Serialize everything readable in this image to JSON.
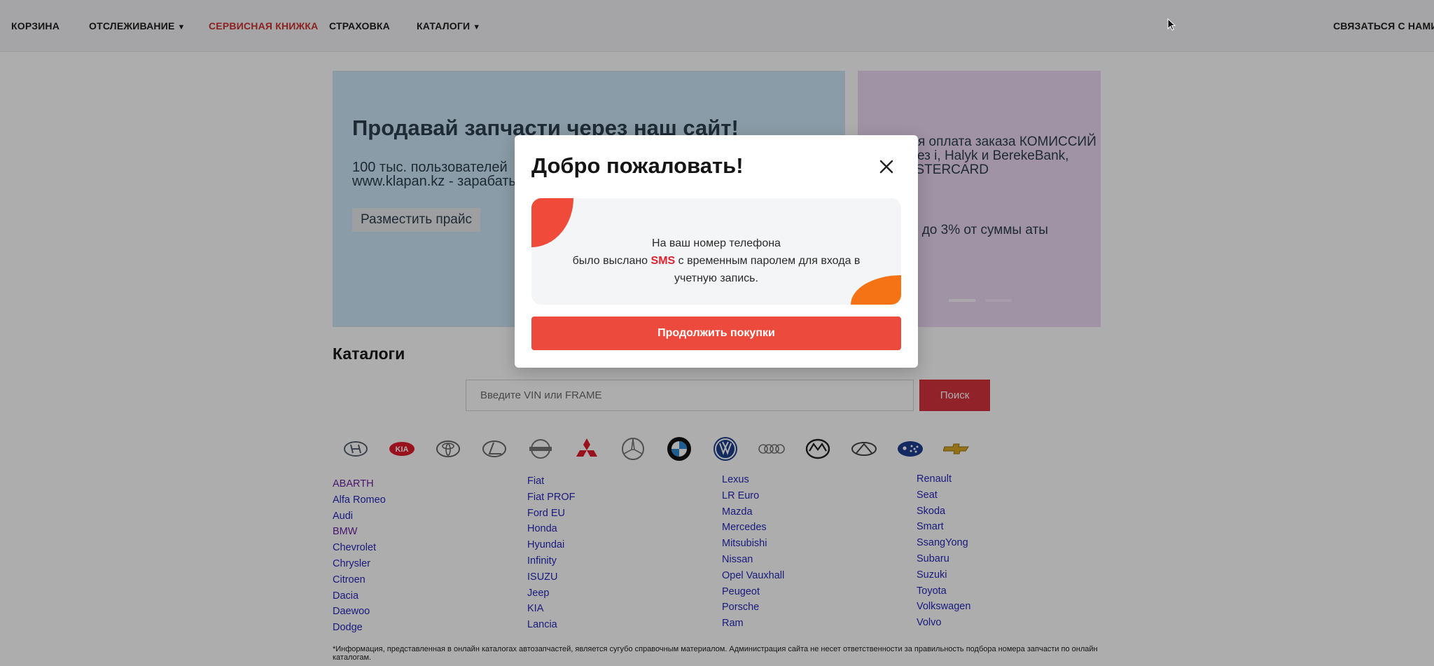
{
  "nav": {
    "cart": "КОРЗИНА",
    "tracking": "ОТСЛЕЖИВАНИЕ",
    "service_book": "СЕРВИСНАЯ КНИЖКА",
    "insurance": "СТРАХОВКА",
    "catalogs": "КАТАЛОГИ",
    "contact": "СВЯЗАТЬСЯ С НАМИ",
    "caret": "▼"
  },
  "banner_left": {
    "title": "Продавай запчасти через наш сайт!",
    "text": "100 тыс. пользователей www.klapan.kz - зарабать",
    "button": "Разместить прайс"
  },
  "banner_right": {
    "text1": "бная оплата заказа КОМИССИЙ через i, Halyk и BerekeBank, MASTERCARD",
    "text2": "усы до 3% от суммы аты"
  },
  "catalog": {
    "title": "Каталоги",
    "vin_placeholder": "Введите VIN или FRAME",
    "search_button": "Поиск"
  },
  "brands": {
    "col1": [
      "ABARTH",
      "Alfa Romeo",
      "Audi",
      "BMW",
      "Chevrolet",
      "Chrysler",
      "Citroen",
      "Dacia",
      "Daewoo",
      "Dodge"
    ],
    "col2": [
      "Fiat",
      "Fiat PROF",
      "Ford EU",
      "Honda",
      "Hyundai",
      "Infinity",
      "ISUZU",
      "Jeep",
      "KIA",
      "Lancia"
    ],
    "col3": [
      "Lexus",
      "LR Euro",
      "Mazda",
      "Mercedes",
      "Mitsubishi",
      "Nissan",
      "Opel Vauxhall",
      "Peugeot",
      "Porsche",
      "Ram"
    ],
    "col4": [
      "Renault",
      "Seat",
      "Skoda",
      "Smart",
      "SsangYong",
      "Subaru",
      "Suzuki",
      "Toyota",
      "Volkswagen",
      "Volvo"
    ]
  },
  "logo_kia_text": "KIA",
  "disclaimer": "*Информация, представленная в онлайн каталогах автозапчастей, является сугубо справочным материалом. Администрация сайта не несет ответственности за правильность подбора номера запчасти по онлайн каталогам.",
  "modal": {
    "title": "Добро пожаловать!",
    "line1": "На ваш номер телефона",
    "line2_pre": "было выслано ",
    "sms": "SMS",
    "line2_post": " с временным паролем для входа в",
    "line3": "учетную запись.",
    "continue_button": "Продолжить покупки"
  },
  "colors": {
    "accent_red": "#ec4a3d",
    "search_red": "#d7333f",
    "active_nav": "#cc3333",
    "link_blue": "#2828b8",
    "link_visited": "#6a22a0"
  }
}
